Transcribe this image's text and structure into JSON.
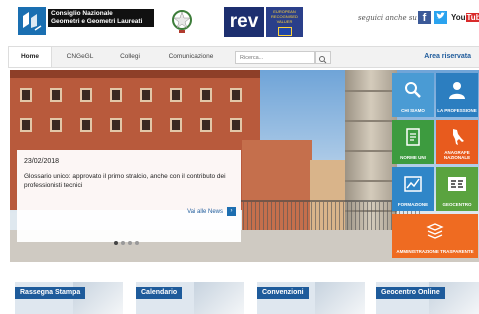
{
  "header": {
    "logo_text_line1": "Consiglio Nazionale",
    "logo_text_line2": "Geometri e Geometri Laureati",
    "rev_label": "rev",
    "rev_side_text": "EUROPEAN RECOGNISED VALUER",
    "social_text": "seguici anche su",
    "facebook": "f",
    "twitter": "t",
    "youtube_prefix": "You",
    "youtube_suffix": "Tube"
  },
  "nav": {
    "items": [
      {
        "label": "Home"
      },
      {
        "label": "CNGeGL"
      },
      {
        "label": "Collegi"
      },
      {
        "label": "Comunicazione"
      }
    ],
    "search_placeholder": "Ricerca...",
    "area_riservata": "Area riservata"
  },
  "hero": {
    "news_date": "23/02/2018",
    "news_text": "Glossario unico: approvato il primo stralcio, anche con il contributo dei professionisti tecnici",
    "news_link": "Vai alle News",
    "active_slide": 1,
    "slides": 4
  },
  "tiles": [
    {
      "label": "CHI SIAMO",
      "icon": "search-icon"
    },
    {
      "label": "LA PROFESSIONE",
      "icon": "person-icon"
    },
    {
      "label": "NORME UNI",
      "icon": "document-icon"
    },
    {
      "label": "ANAGRAFE NAZIONALE",
      "icon": "italy-map-icon"
    },
    {
      "label": "FORMAZIONE",
      "icon": "chart-icon"
    },
    {
      "label": "GEOCENTRO",
      "icon": "geo-logo-icon"
    },
    {
      "label": "AMMINISTRAZIONE TRASPARENTE",
      "icon": "books-icon"
    }
  ],
  "cards": [
    {
      "label": "Rassegna Stampa"
    },
    {
      "label": "Calendario"
    },
    {
      "label": "Convenzioni"
    },
    {
      "label": "Geocentro Online"
    }
  ],
  "colors": {
    "brand_blue": "#1e5b9b",
    "tile_orange": "#ef6b21",
    "tile_green": "#3d9b3f"
  }
}
